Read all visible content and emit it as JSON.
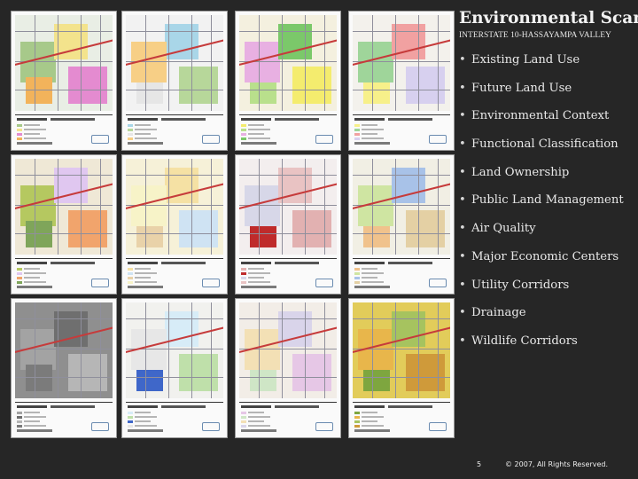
{
  "slide": {
    "title": "Environmental Scan",
    "subtitle": "INTERSTATE 10-HASSAYAMPA VALLEY",
    "topics": [
      "Existing Land Use",
      "Future Land Use",
      "Environmental Context",
      "Functional Classification",
      "Land Ownership",
      "Public Land Management",
      "Air Quality",
      "Major Economic Centers",
      "Utility Corridors",
      "Drainage",
      "Wildlife Corridors"
    ],
    "bullet_glyph": "•",
    "page_number": "5",
    "copyright": "© 2007, All Rights Reserved."
  },
  "map_thumbnails": [
    {
      "theme": "existing-land-use",
      "base": "#e9eee5",
      "zones": [
        "#a7c98a",
        "#f3e38c",
        "#e48bd0",
        "#f2b35b"
      ]
    },
    {
      "theme": "functional-classification",
      "base": "#f2f2f2",
      "zones": [
        "#a9d6e8",
        "#b7d79a",
        "#e6e6e6",
        "#f7cf86"
      ]
    },
    {
      "theme": "environmental-context",
      "base": "#f4f0df",
      "zones": [
        "#f4ec6e",
        "#b9e08c",
        "#e8b0e2",
        "#7bc86a"
      ]
    },
    {
      "theme": "utility-corridors",
      "base": "#f3f1ec",
      "zones": [
        "#f7f08a",
        "#9fd59a",
        "#f1a1a1",
        "#d7d0ef"
      ]
    },
    {
      "theme": "future-land-use",
      "base": "#efe8d6",
      "zones": [
        "#b5c860",
        "#e0c7f0",
        "#f1a46c",
        "#7fa55a"
      ]
    },
    {
      "theme": "land-ownership",
      "base": "#f6f1d8",
      "zones": [
        "#f5e1a4",
        "#cfe3f3",
        "#e9d2a9",
        "#f7f3c8"
      ]
    },
    {
      "theme": "major-economic-centers",
      "base": "#f3eeee",
      "zones": [
        "#e2b1b1",
        "#bf2b2b",
        "#d7d7e8",
        "#e9c3c3"
      ]
    },
    {
      "theme": "drainage",
      "base": "#f1efe4",
      "zones": [
        "#f0c28c",
        "#cfe5a2",
        "#a8c2e8",
        "#e4d0a4"
      ]
    },
    {
      "theme": "environmental-context-relief",
      "base": "#8f8f8f",
      "zones": [
        "#a3a3a3",
        "#6f6f6f",
        "#b6b6b6",
        "#7b7b7b"
      ]
    },
    {
      "theme": "public-land-management",
      "base": "#f1f1ee",
      "zones": [
        "#d7ecf7",
        "#bfe0aa",
        "#3f67c9",
        "#e7e7e7"
      ]
    },
    {
      "theme": "air-quality",
      "base": "#f2ede7",
      "zones": [
        "#e6c7e6",
        "#cfe6c6",
        "#f3e0b5",
        "#d9d4ea"
      ]
    },
    {
      "theme": "wildlife-corridors",
      "base": "#e2cc5a",
      "zones": [
        "#7ea63f",
        "#e8b64b",
        "#a6c35f",
        "#cf9a3a"
      ]
    }
  ],
  "colors": {
    "background": "#262626",
    "title": "#f2f2f2",
    "body_text": "#e8e8e8",
    "highway": "#c63b3b"
  }
}
